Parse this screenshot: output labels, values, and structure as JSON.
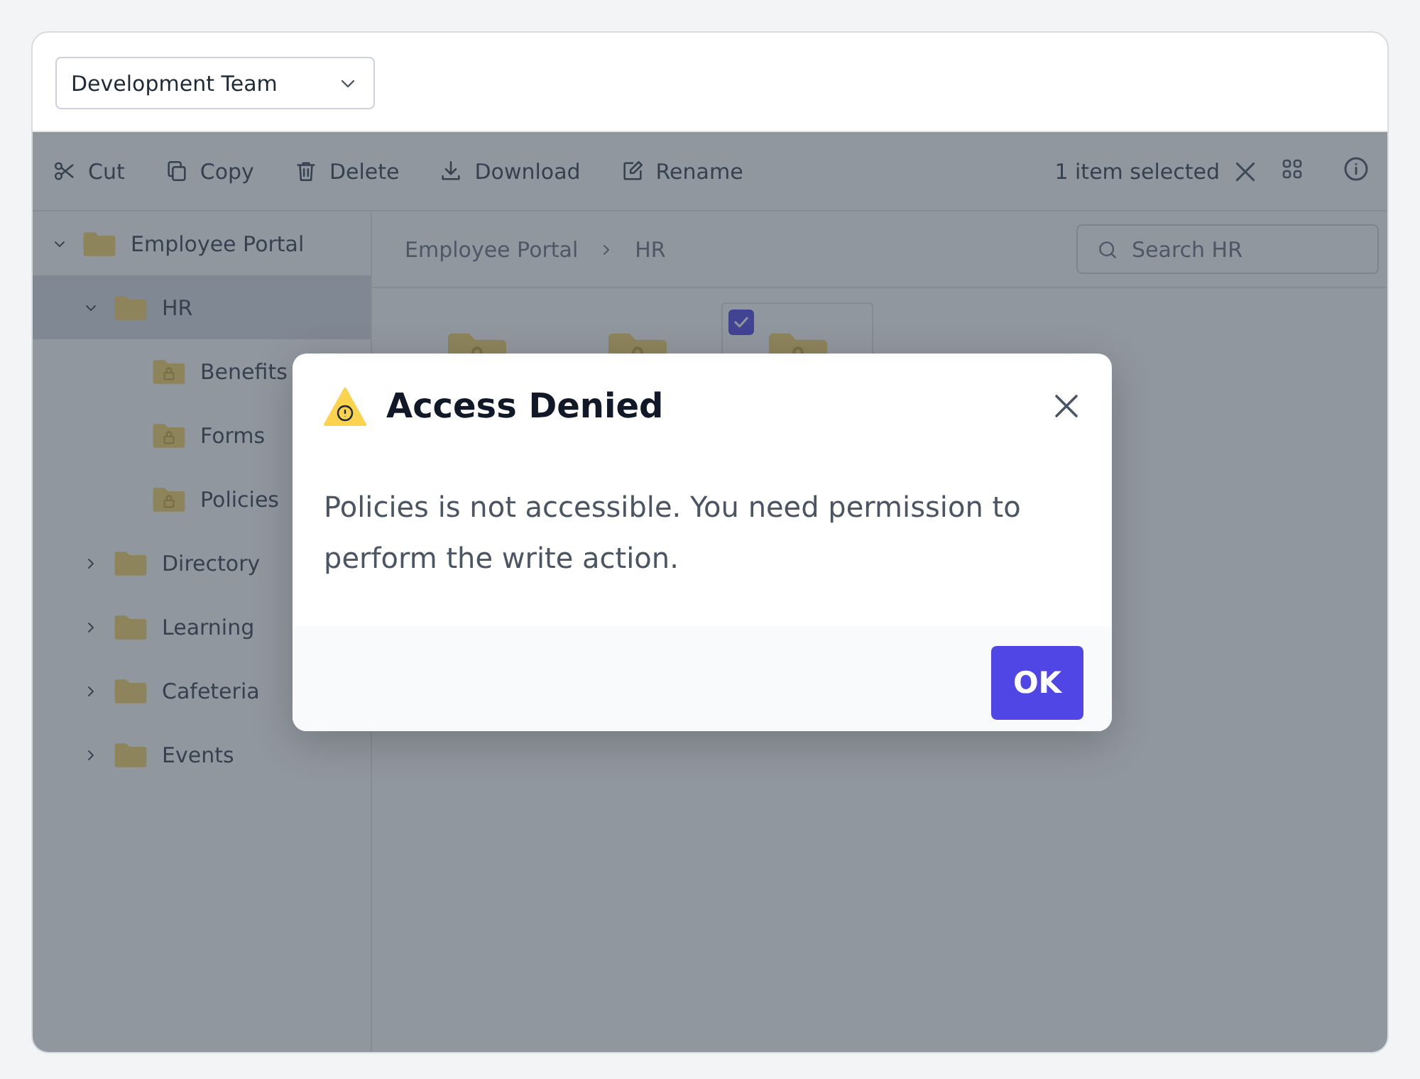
{
  "team_select": {
    "value": "Development Team"
  },
  "toolbar": {
    "actions": [
      {
        "label": "Cut",
        "kind": "cut"
      },
      {
        "label": "Copy",
        "kind": "copy"
      },
      {
        "label": "Delete",
        "kind": "delete"
      },
      {
        "label": "Download",
        "kind": "download"
      },
      {
        "label": "Rename",
        "kind": "rename"
      }
    ],
    "selection_text": "1 item selected"
  },
  "tree": [
    {
      "label": "Employee Portal",
      "expanded": true,
      "selected": false,
      "locked": false,
      "children": [
        {
          "label": "HR",
          "expanded": true,
          "selected": true,
          "locked": false,
          "children": [
            {
              "label": "Benefits",
              "selected": false,
              "locked": true
            },
            {
              "label": "Forms",
              "selected": false,
              "locked": true
            },
            {
              "label": "Policies",
              "selected": false,
              "locked": true
            }
          ]
        },
        {
          "label": "Directory",
          "expanded": false,
          "selected": false,
          "locked": false
        },
        {
          "label": "Learning",
          "expanded": false,
          "selected": false,
          "locked": false
        },
        {
          "label": "Cafeteria",
          "expanded": false,
          "selected": false,
          "locked": false
        },
        {
          "label": "Events",
          "expanded": false,
          "selected": false,
          "locked": false
        }
      ]
    }
  ],
  "breadcrumb": [
    "Employee Portal",
    "HR"
  ],
  "search": {
    "placeholder": "Search HR"
  },
  "tiles": [
    {
      "selected": false
    },
    {
      "selected": false
    },
    {
      "selected": true
    }
  ],
  "dialog": {
    "title": "Access Denied",
    "message": "Policies is not accessible. You need permission to perform the write action.",
    "button": "OK"
  }
}
